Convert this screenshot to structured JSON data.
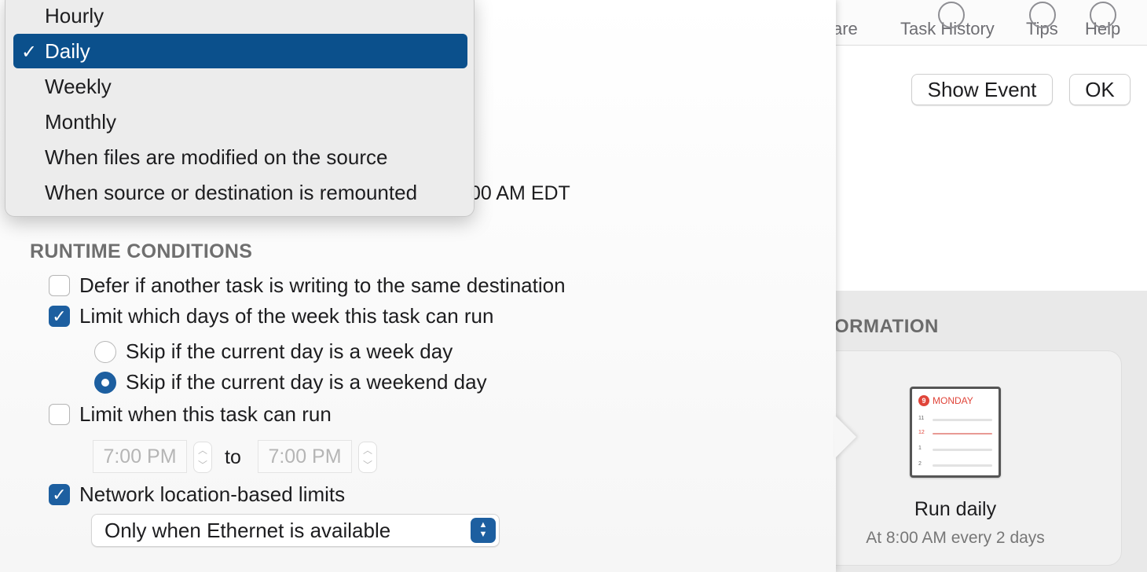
{
  "toolbar": {
    "share_partial": "are",
    "task_history": "Task History",
    "tips": "Tips",
    "help": "Help"
  },
  "buttons": {
    "show_event": "Show Event",
    "ok": "OK"
  },
  "info_section": {
    "title_partial": "ORMATION",
    "card_title": "Run daily",
    "card_subtitle": "At 8:00 AM every 2 days",
    "calendar_icon": {
      "day_number": "9",
      "weekday": "MONDAY",
      "hours": [
        "11",
        "12",
        "1",
        "2"
      ]
    }
  },
  "schedule": {
    "time_partial": "00 AM EDT"
  },
  "frequency_menu": {
    "items": [
      {
        "label": "Hourly",
        "selected": false
      },
      {
        "label": "Daily",
        "selected": true
      },
      {
        "label": "Weekly",
        "selected": false
      },
      {
        "label": "Monthly",
        "selected": false
      },
      {
        "label": "When files are modified on the source",
        "selected": false
      },
      {
        "label": "When source or destination is remounted",
        "selected": false
      }
    ],
    "check_glyph": "✓"
  },
  "runtime": {
    "title": "RUNTIME CONDITIONS",
    "defer": {
      "label": "Defer if another task is writing to the same destination",
      "checked": false
    },
    "limit_days": {
      "label": "Limit which days of the week this task can run",
      "checked": true
    },
    "skip_weekday": {
      "label": "Skip if the current day is a week day",
      "selected": false
    },
    "skip_weekend": {
      "label": "Skip if the current day is a weekend day",
      "selected": true
    },
    "limit_time": {
      "label": "Limit when this task can run",
      "checked": false
    },
    "time_from": "7:00 PM",
    "time_to": "7:00 PM",
    "to_label": "to",
    "network": {
      "label": "Network location-based limits",
      "checked": true
    },
    "network_option": "Only when Ethernet is available"
  },
  "colors": {
    "accent": "#1d5fa0",
    "menu_selection": "#0b508c"
  }
}
